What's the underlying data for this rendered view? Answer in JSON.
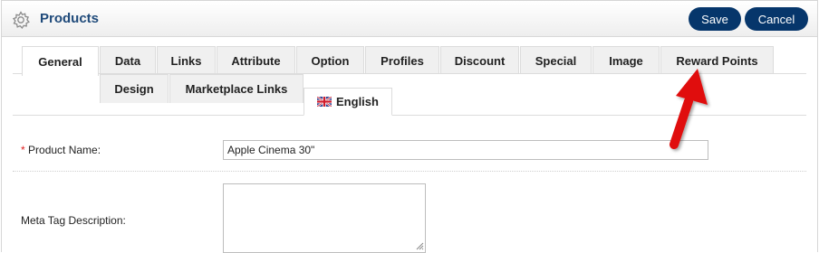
{
  "header": {
    "icon": "gear-icon",
    "title": "Products",
    "save_label": "Save",
    "cancel_label": "Cancel"
  },
  "tabs_row1": [
    "General",
    "Data",
    "Links",
    "Attribute",
    "Option",
    "Profiles",
    "Discount",
    "Special",
    "Image",
    "Reward Points"
  ],
  "tabs_row2": [
    "Design",
    "Marketplace Links"
  ],
  "active_tab": "General",
  "language_tab": {
    "label": "English",
    "icon": "uk-flag-icon"
  },
  "form": {
    "product_name": {
      "required_marker": "*",
      "label": "Product Name:",
      "value": "Apple Cinema 30\""
    },
    "meta_description": {
      "label": "Meta Tag Description:",
      "value": ""
    }
  },
  "annotation": {
    "icon": "red-arrow-icon",
    "color": "#e01010"
  },
  "colors": {
    "button": "#06366b",
    "title": "#1f4a7a",
    "required": "#e02020"
  }
}
